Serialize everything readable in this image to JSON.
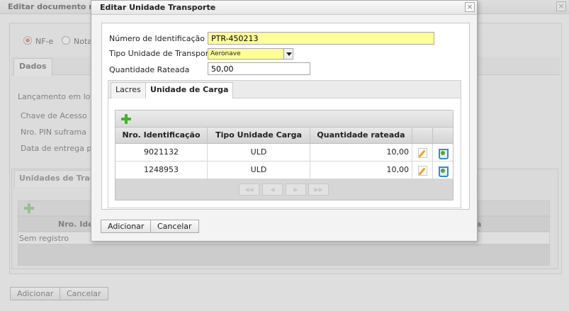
{
  "background": {
    "title": "Editar documento rem",
    "radio_nfe": "NF-e",
    "radio_nota": "Nota",
    "tab_dados": "Dados",
    "labels": {
      "lancamento": "Lançamento em lote?",
      "chave": "Chave de Acesso",
      "pin": "Nro. PIN suframa",
      "data_entrega": "Data de entrega prev"
    },
    "unidades_tab": "Unidades de Transp",
    "grid_head_nro": "Nro. Iden",
    "grid_head_right": "a",
    "sem_registro": "Sem registro",
    "btn_add": "Adicionar",
    "btn_cancel": "Cancelar"
  },
  "dialog": {
    "title": "Editar Unidade Transporte",
    "fields": {
      "numero_label": "Número de Identificação",
      "numero_value": "PTR-450213",
      "tipo_label": "Tipo Unidade de Transporte",
      "tipo_value": "Aeronave",
      "qtd_label": "Quantidade Rateada",
      "qtd_value": "50,00"
    },
    "tabs": [
      {
        "label": "Lacres",
        "active": false
      },
      {
        "label": "Unidade de Carga",
        "active": true
      }
    ],
    "grid": {
      "columns": [
        "Nro. Identificação",
        "Tipo Unidade Carga",
        "Quantidade rateada"
      ],
      "rows": [
        {
          "nro": "9021132",
          "tipo": "ULD",
          "qtd": "10,00"
        },
        {
          "nro": "1248953",
          "tipo": "ULD",
          "qtd": "10,00"
        }
      ],
      "pager": {
        "first": "◀◀",
        "prev": "◀",
        "next": "▶",
        "last": "▶▶"
      }
    },
    "btn_add": "Adicionar",
    "btn_cancel": "Cancelar"
  },
  "icons": {
    "add": "plus-icon",
    "edit": "pencil-icon",
    "delete": "trash-icon",
    "close": "close-icon"
  },
  "colors": {
    "required_field_bg": "#ffff99",
    "add_icon": "#45b02c"
  }
}
